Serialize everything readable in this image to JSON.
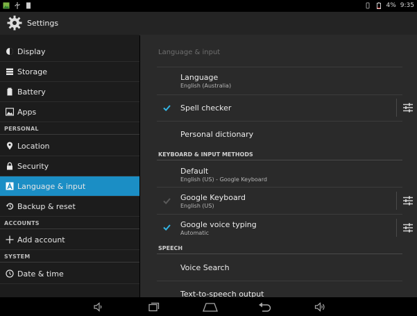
{
  "status_bar": {
    "battery": "4%",
    "time": "9:35"
  },
  "action_bar": {
    "title": "Settings",
    "icon": "settings-gear-icon"
  },
  "sidebar": {
    "items": [
      {
        "label": "Display",
        "icon": "display-icon"
      },
      {
        "label": "Storage",
        "icon": "storage-icon"
      },
      {
        "label": "Battery",
        "icon": "battery-icon"
      },
      {
        "label": "Apps",
        "icon": "apps-icon"
      },
      {
        "label": "Location",
        "icon": "location-icon"
      },
      {
        "label": "Security",
        "icon": "lock-icon"
      },
      {
        "label": "Language & input",
        "icon": "language-icon"
      },
      {
        "label": "Backup & reset",
        "icon": "backup-icon"
      },
      {
        "label": "Add account",
        "icon": "add-icon"
      },
      {
        "label": "Date & time",
        "icon": "clock-icon"
      }
    ],
    "headers": {
      "personal": "PERSONAL",
      "accounts": "ACCOUNTS",
      "system": "SYSTEM"
    },
    "active_color": "#1b8ec5"
  },
  "content": {
    "title": "Language & input",
    "language": {
      "title": "Language",
      "summary": "English (Australia)"
    },
    "spell_checker": {
      "title": "Spell checker",
      "checked": true
    },
    "personal_dictionary": {
      "title": "Personal dictionary"
    },
    "section_keyboard": "KEYBOARD & INPUT METHODS",
    "default": {
      "title": "Default",
      "summary": "English (US) - Google Keyboard"
    },
    "google_keyboard": {
      "title": "Google Keyboard",
      "summary": "English (US)",
      "checked": true,
      "enabled": false
    },
    "google_voice": {
      "title": "Google voice typing",
      "summary": "Automatic",
      "checked": true
    },
    "section_speech": "SPEECH",
    "voice_search": {
      "title": "Voice Search"
    },
    "tts": {
      "title": "Text-to-speech output"
    }
  },
  "nav_bar": {
    "buttons": [
      "volume-down-icon",
      "recent-apps-icon",
      "home-icon",
      "back-icon",
      "volume-up-icon"
    ]
  }
}
